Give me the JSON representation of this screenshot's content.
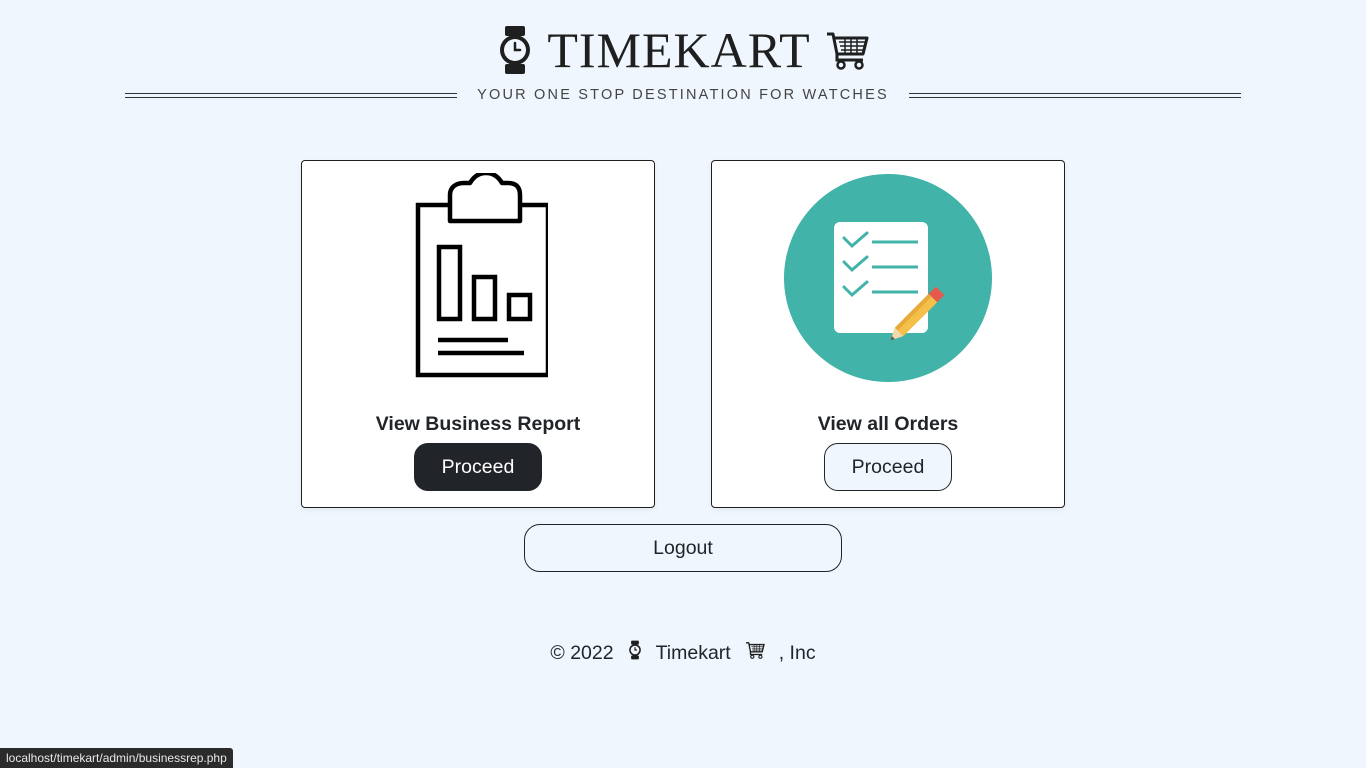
{
  "header": {
    "brand_name": "TIMEKART",
    "tagline": "YOUR ONE STOP DESTINATION FOR WATCHES",
    "icons": [
      "watch-icon",
      "cart-icon"
    ]
  },
  "cards": [
    {
      "icon": "business-report-clipboard-icon",
      "title": "View Business Report",
      "button_label": "Proceed"
    },
    {
      "icon": "orders-checklist-icon",
      "title": "View all Orders",
      "button_label": "Proceed"
    }
  ],
  "logout_label": "Logout",
  "footer": {
    "copyright": "© 2022",
    "brand": "Timekart",
    "suffix": ", Inc"
  },
  "status_bar_url": "localhost/timekart/admin/businessrep.php",
  "colors": {
    "page_background": "#eff6fe",
    "dark_button": "#212529",
    "orders_circle": "#41b3a9",
    "pencil_body": "#f5c04a",
    "pencil_tip": "#e65a4d"
  }
}
